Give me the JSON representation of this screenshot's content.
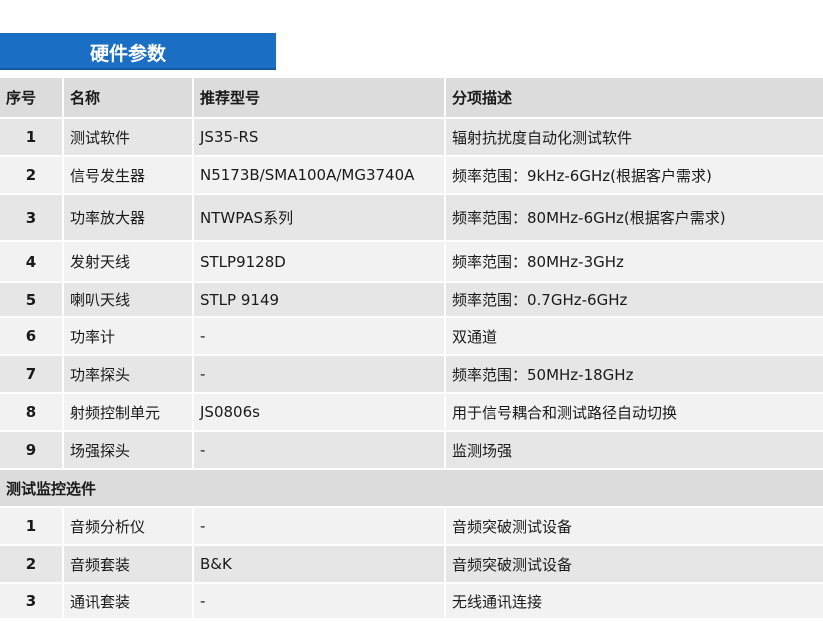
{
  "title": "硬件参数",
  "header": {
    "col1": "序号",
    "col2": "名称",
    "col3": "推荐型号",
    "col4": "分项描述"
  },
  "rows": [
    {
      "no": "1",
      "name": "测试软件",
      "model": "JS35-RS",
      "desc": "辐射抗扰度自动化测试软件"
    },
    {
      "no": "2",
      "name": "信号发生器",
      "model": "N5173B/SMA100A/MG3740A",
      "desc": "频率范围：9kHz-6GHz(根据客户需求)"
    },
    {
      "no": "3",
      "name": "功率放大器",
      "model": "NTWPAS系列",
      "desc": "频率范围：80MHz-6GHz(根据客户需求)"
    },
    {
      "no": "4",
      "name": "发射天线",
      "model": "STLP9128D",
      "desc": "频率范围：80MHz-3GHz"
    },
    {
      "no": "5",
      "name": "喇叭天线",
      "model": "STLP 9149",
      "desc": "频率范围：0.7GHz-6GHz"
    },
    {
      "no": "6",
      "name": "功率计",
      "model": "-",
      "desc": "双通道"
    },
    {
      "no": "7",
      "name": "功率探头",
      "model": "-",
      "desc": "频率范围：50MHz-18GHz"
    },
    {
      "no": "8",
      "name": "射频控制单元",
      "model": "JS0806s",
      "desc": "用于信号耦合和测试路径自动切换"
    },
    {
      "no": "9",
      "name": "场强探头",
      "model": "-",
      "desc": "监测场强"
    }
  ],
  "section2": {
    "title": "测试监控选件",
    "rows": [
      {
        "no": "1",
        "name": "音频分析仪",
        "model": "-",
        "desc": "音频突破测试设备"
      },
      {
        "no": "2",
        "name": "音频套装",
        "model": "B&K",
        "desc": "音频突破测试设备"
      },
      {
        "no": "3",
        "name": "通讯套装",
        "model": "-",
        "desc": "无线通讯连接"
      }
    ]
  }
}
